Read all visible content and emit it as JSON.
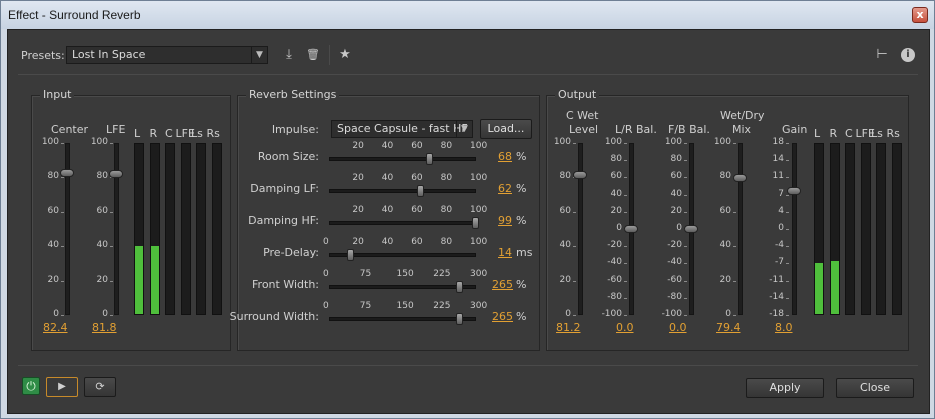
{
  "window": {
    "title": "Effect - Surround Reverb",
    "close_glyph": "x"
  },
  "presets": {
    "label": "Presets:",
    "selected": "Lost In Space"
  },
  "input": {
    "title": "Input",
    "center_label": "Center",
    "lfe_label": "LFE",
    "scale": [
      "100",
      "80",
      "60",
      "40",
      "20",
      "0"
    ],
    "center_value": "82.4",
    "lfe_value": "81.8",
    "meters": [
      "L",
      "R",
      "C",
      "LFE",
      "Ls",
      "Rs"
    ],
    "meter_levels": [
      0.4,
      0.4,
      0,
      0,
      0,
      0
    ]
  },
  "reverb": {
    "title": "Reverb Settings",
    "impulse_label": "Impulse:",
    "impulse_value": "Space Capsule - fast HF",
    "load_label": "Load...",
    "rows": [
      {
        "label": "Room Size:",
        "scale": [
          "20",
          "40",
          "60",
          "80",
          "100"
        ],
        "value": "68",
        "unit": "%",
        "level": 0.68
      },
      {
        "label": "Damping LF:",
        "scale": [
          "20",
          "40",
          "60",
          "80",
          "100"
        ],
        "value": "62",
        "unit": "%",
        "level": 0.62
      },
      {
        "label": "Damping HF:",
        "scale": [
          "20",
          "40",
          "60",
          "80",
          "100"
        ],
        "value": "99",
        "unit": "%",
        "level": 0.99
      },
      {
        "label": "Pre-Delay:",
        "scale": [
          "0",
          "20",
          "40",
          "60",
          "80",
          "100"
        ],
        "value": "14",
        "unit": "ms",
        "level": 0.14
      },
      {
        "label": "Front Width:",
        "scale": [
          "0",
          "75",
          "150",
          "225",
          "300"
        ],
        "value": "265",
        "unit": "%",
        "level": 0.883
      },
      {
        "label": "Surround Width:",
        "scale": [
          "0",
          "75",
          "150",
          "225",
          "300"
        ],
        "value": "265",
        "unit": "%",
        "level": 0.883
      }
    ]
  },
  "output": {
    "title": "Output",
    "c_wet_label_1": "C Wet",
    "c_wet_label_2": "Level",
    "lr_label": "L/R Bal.",
    "fb_label": "F/B Bal.",
    "wetdry_label_1": "Wet/Dry",
    "wetdry_label_2": "Mix",
    "gain_label": "Gain",
    "scale_pos": [
      "100",
      "80",
      "60",
      "40",
      "20",
      "0"
    ],
    "scale_bal": [
      "100",
      "80",
      "60",
      "40",
      "20",
      "0",
      "-20",
      "-40",
      "-60",
      "-80",
      "-100"
    ],
    "scale_gain": [
      "18",
      "14",
      "11",
      "7",
      "4",
      "0",
      "-4",
      "-7",
      "-11",
      "-14",
      "-18"
    ],
    "c_wet_value": "81.2",
    "lr_value": "0.0",
    "fb_value": "0.0",
    "wetdry_value": "79.4",
    "gain_value": "8.0",
    "meters": [
      "L",
      "R",
      "C",
      "LFE",
      "Ls",
      "Rs"
    ],
    "meter_levels": [
      0.3,
      0.31,
      0,
      0,
      0,
      0
    ]
  },
  "footer": {
    "apply_label": "Apply",
    "close_label": "Close"
  },
  "icons": {
    "save": "⤓",
    "delete": "🗑",
    "favorite": "★",
    "routing": "⊢",
    "info": "i",
    "power": "⏻",
    "play": "▶",
    "loop": "⟳"
  }
}
